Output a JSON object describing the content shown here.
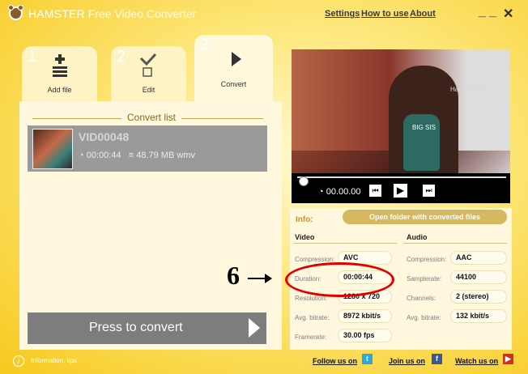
{
  "app": {
    "brand": "HAMSTER",
    "title_rest": "Free Video Converter"
  },
  "menu": {
    "settings": "Settings",
    "how_to_use": "How to use",
    "about": "About"
  },
  "window": {
    "minimize": "_",
    "maximize": "_",
    "close": "✕"
  },
  "tabs": [
    {
      "num": "1",
      "label": "Add file"
    },
    {
      "num": "2",
      "label": "Edit"
    },
    {
      "num": "3",
      "label": "Convert"
    }
  ],
  "convert_list": {
    "title": "Convert list",
    "item": {
      "name": "VID00048",
      "duration": "00:00:44",
      "size_format": "48.79 MB wmv"
    }
  },
  "convert_button": {
    "label": "Press to convert"
  },
  "player": {
    "timecode": "00.00.00",
    "overlay_sign": "Hamm Center",
    "overlay_shirt": "BIG SIS"
  },
  "info": {
    "label": "Info:",
    "open_folder": "Open folder with converted files",
    "video_heading": "Video",
    "audio_heading": "Audio",
    "video": {
      "compression_key": "Compression:",
      "compression": "AVC",
      "duration_key": "Duration:",
      "duration": "00:00:44",
      "resolution_key": "Resolution:",
      "resolution": "1280 x 720",
      "bitrate_key": "Avg. bitrate:",
      "bitrate": "8972 kbit/s",
      "framerate_key": "Framerate:",
      "framerate": "30.00 fps"
    },
    "audio": {
      "compression_key": "Compression:",
      "compression": "AAC",
      "samplerate_key": "Samplerate:",
      "samplerate": "44100",
      "channels_key": "Channels:",
      "channels": "2 (stereo)",
      "bitrate_key": "Avg. bitrate:",
      "bitrate": "132 kbit/s"
    }
  },
  "annotation": {
    "number": "6"
  },
  "footer": {
    "tips": "Information, tips",
    "follow": "Follow us on",
    "join": "Join us on",
    "watch": "Watch us on"
  },
  "colors": {
    "accent": "#f7c91e",
    "panel": "#fff8de",
    "highlight": "#e00000"
  }
}
